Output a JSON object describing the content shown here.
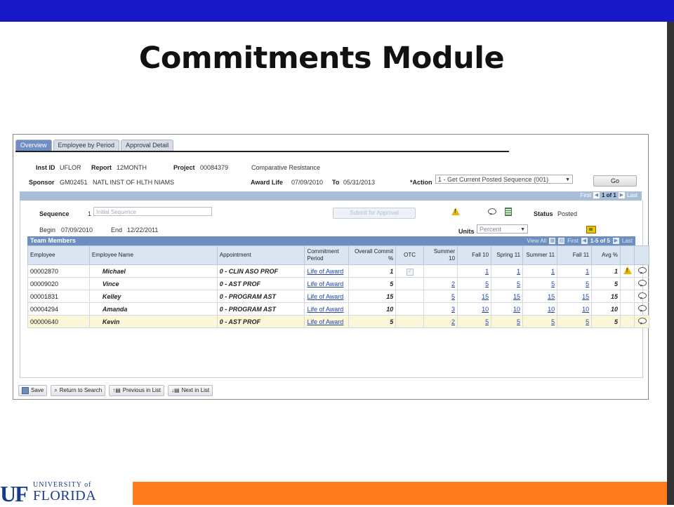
{
  "slide": {
    "title": "Commitments Module"
  },
  "tabs": [
    "Overview",
    "Employee by Period",
    "Approval Detail"
  ],
  "header": {
    "inst_id_label": "Inst ID",
    "inst_id": "UFLOR",
    "report_label": "Report",
    "report": "12MONTH",
    "project_label": "Project",
    "project": "00084379",
    "project_desc": "Comparative Resistance",
    "sponsor_label": "Sponsor",
    "sponsor": "GM02451",
    "sponsor_name": "NATL INST OF HLTH NIAMS",
    "award_life_label": "Award Life",
    "award_begin": "07/09/2010",
    "to_label": "To",
    "award_end": "05/31/2013",
    "action_label": "*Action",
    "action_value": "1 - Get Current Posted Sequence (001)",
    "go_label": "Go"
  },
  "seq_nav": {
    "first": "First",
    "range": "1 of 1",
    "last": "Last"
  },
  "sequence": {
    "sequence_label": "Sequence",
    "sequence_no": "1",
    "sequence_placeholder": "Initial Sequence",
    "submit_label": "Submit for Approval",
    "status_label": "Status",
    "status": "Posted",
    "begin_label": "Begin",
    "begin": "07/09/2010",
    "end_label": "End",
    "end": "12/22/2011",
    "units_label": "Units",
    "units_value": "Percent"
  },
  "team": {
    "title": "Team Members",
    "nav": {
      "view_all": "View All",
      "first": "First",
      "range": "1-5 of 5",
      "last": "Last"
    },
    "columns": [
      "Employee",
      "Employee Name",
      "Appointment",
      "Commitment Period",
      "Overall Commit %",
      "OTC",
      "Summer 10",
      "Fall 10",
      "Spring 11",
      "Summer 11",
      "Fall 11",
      "Avg %"
    ],
    "rows": [
      {
        "emp": "00002870",
        "name": "Michael",
        "appt": "0 - CLIN ASO PROF",
        "period": "Life of Award",
        "overall": "1",
        "s10": "",
        "f10": "1",
        "sp11": "1",
        "s11": "1",
        "f11": "1",
        "avg": "1"
      },
      {
        "emp": "00009020",
        "name": "Vince",
        "appt": "0 - AST PROF",
        "period": "Life of Award",
        "overall": "5",
        "s10": "2",
        "f10": "5",
        "sp11": "5",
        "s11": "5",
        "f11": "5",
        "avg": "5"
      },
      {
        "emp": "00001831",
        "name": "Kelley",
        "appt": "0 - PROGRAM AST",
        "period": "Life of Award",
        "overall": "15",
        "s10": "5",
        "f10": "15",
        "sp11": "15",
        "s11": "15",
        "f11": "15",
        "avg": "15"
      },
      {
        "emp": "00004294",
        "name": "Amanda",
        "appt": "0 - PROGRAM AST",
        "period": "Life of Award",
        "overall": "10",
        "s10": "3",
        "f10": "10",
        "sp11": "10",
        "s11": "10",
        "f11": "10",
        "avg": "10"
      },
      {
        "emp": "00000640",
        "name": "Kevin",
        "appt": "0 - AST PROF",
        "period": "Life of Award",
        "overall": "5",
        "s10": "2",
        "f10": "5",
        "sp11": "5",
        "s11": "5",
        "f11": "5",
        "avg": "5"
      }
    ]
  },
  "buttons": {
    "save": "Save",
    "return": "Return to Search",
    "previous": "Previous in List",
    "next": "Next in List"
  },
  "logo": {
    "mark": "UF",
    "line1": "UNIVERSITY of",
    "line2": "FLORIDA"
  },
  "colors": {
    "top_bar": "#1818c8",
    "footer": "#ff7b1c",
    "grid_header": "#6c8fbf"
  }
}
